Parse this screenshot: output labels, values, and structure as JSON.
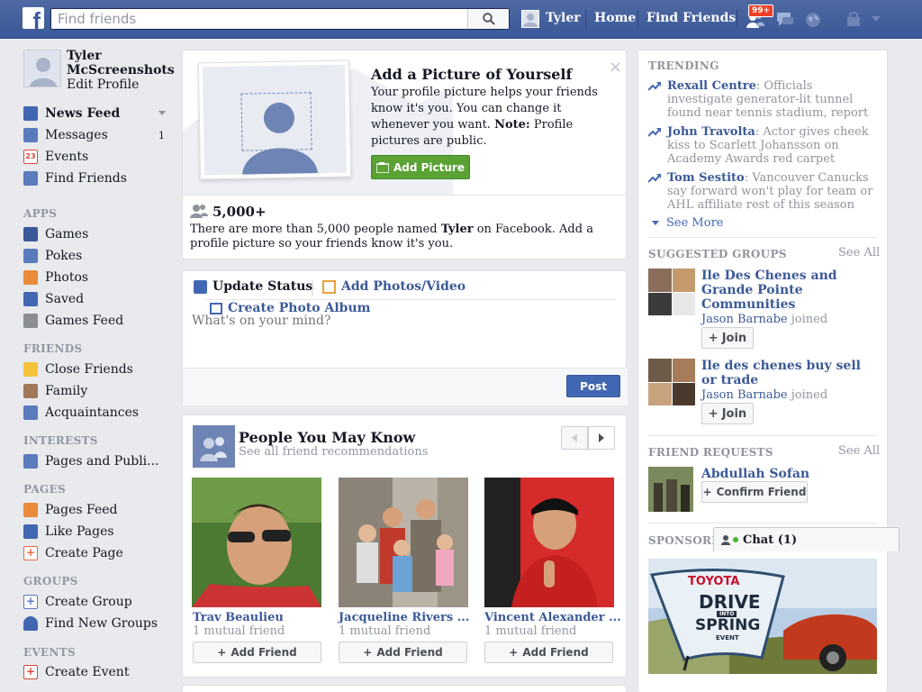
{
  "topbar": {
    "logo": "f",
    "search_placeholder": "Find friends",
    "user": "Tyler",
    "home": "Home",
    "find_friends": "Find Friends",
    "notif_count": "99+"
  },
  "profile": {
    "name_first": "Tyler",
    "name_last": "McScreenshots",
    "edit": "Edit Profile"
  },
  "sidebar": {
    "favorites": [
      {
        "label": "News Feed",
        "color": "#4267b2"
      },
      {
        "label": "Messages",
        "count": "1",
        "color": "#5a7bbd"
      },
      {
        "label": "Events",
        "color": "#d8473d"
      },
      {
        "label": "Find Friends",
        "color": "#5a7bbd"
      }
    ],
    "apps_header": "APPS",
    "apps": [
      {
        "label": "Games",
        "color": "#3b5998"
      },
      {
        "label": "Pokes",
        "color": "#5a7bbd"
      },
      {
        "label": "Photos",
        "color": "#e98b3b"
      },
      {
        "label": "Saved",
        "color": "#4267b2"
      },
      {
        "label": "Games Feed",
        "color": "#8a8d91"
      }
    ],
    "friends_header": "FRIENDS",
    "friends": [
      {
        "label": "Close Friends",
        "color": "#f5c33b"
      },
      {
        "label": "Family",
        "color": "#a0785a"
      },
      {
        "label": "Acquaintances",
        "color": "#5a7bbd"
      }
    ],
    "interests_header": "INTERESTS",
    "interests": [
      {
        "label": "Pages and Publi...",
        "color": "#5a7bbd"
      }
    ],
    "pages_header": "PAGES",
    "pages": [
      {
        "label": "Pages Feed",
        "color": "#e98b3b"
      },
      {
        "label": "Like Pages",
        "color": "#4267b2"
      },
      {
        "label": "Create Page",
        "color": "#e96a3b"
      }
    ],
    "groups_header": "GROUPS",
    "groups": [
      {
        "label": "Create Group",
        "color": "#5a7bbd"
      },
      {
        "label": "Find New Groups",
        "color": "#4267b2"
      }
    ],
    "events_header": "EVENTS",
    "events": [
      {
        "label": "Create Event",
        "color": "#d8473d"
      }
    ]
  },
  "add_picture": {
    "title": "Add a Picture of Yourself",
    "body_a": "Your profile picture helps your friends know it's you. You can change it whenever you want.",
    "note_label": "Note:",
    "body_b": "Profile pictures are public.",
    "button": "Add Picture",
    "close": "×",
    "count": "5,000+",
    "named_a": "There are more than 5,000 people named",
    "named_name": "Tyler",
    "named_b": "on Facebook. Add a profile picture so your friends know it's you."
  },
  "composer": {
    "update_status": "Update Status",
    "add_photos": "Add Photos/Video",
    "create_album": "Create Photo Album",
    "placeholder": "What's on your mind?",
    "post": "Post"
  },
  "pymk": {
    "title": "People You May Know",
    "subtitle": "See all friend recommendations",
    "people": [
      {
        "name": "Trav Beaulieu",
        "mutual": "1 mutual friend",
        "add": "Add Friend"
      },
      {
        "name": "Jacqueline Rivers ...",
        "mutual": "1 mutual friend",
        "add": "Add Friend"
      },
      {
        "name": "Vincent Alexander ...",
        "mutual": "1 mutual friend",
        "add": "Add Friend"
      }
    ]
  },
  "trending": {
    "header": "TRENDING",
    "items": [
      {
        "name": "Rexall Centre",
        "desc": ": Officials investigate generator-lit tunnel found near tennis stadium, report"
      },
      {
        "name": "John Travolta",
        "desc": ": Actor gives cheek kiss to Scarlett Johansson on Academy Awards red carpet"
      },
      {
        "name": "Tom Sestito",
        "desc": ": Vancouver Canucks say forward won't play for team or AHL affiliate rest of this season"
      }
    ],
    "see_more": "See More"
  },
  "groups": {
    "header": "SUGGESTED GROUPS",
    "see_all": "See All",
    "items": [
      {
        "name": "Ile Des Chenes and Grande Pointe Communities",
        "joined_name": "Jason Barnabe",
        "joined": "joined",
        "join": "Join"
      },
      {
        "name": "Ile des chenes buy sell or trade",
        "joined_name": "Jason Barnabe",
        "joined": "joined",
        "join": "Join"
      }
    ]
  },
  "requests": {
    "header": "FRIEND REQUESTS",
    "see_all": "See All",
    "name": "Abdullah Sofan",
    "confirm": "Confirm Friend"
  },
  "sponsored": {
    "header": "SPONSORED",
    "ad_brand": "TOYOTA",
    "ad_line1": "DRIVE",
    "ad_into": "INTO",
    "ad_line2": "SPRING",
    "ad_event": "EVENT"
  },
  "chat": {
    "label": "Chat (1)"
  }
}
